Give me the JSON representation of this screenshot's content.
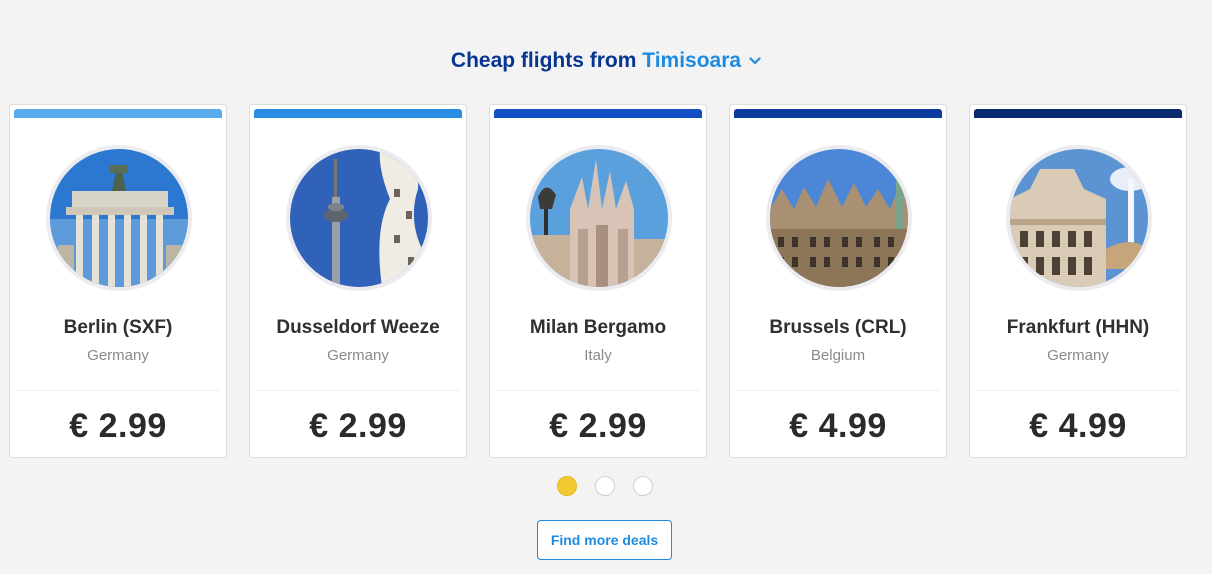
{
  "heading": {
    "prefix": "Cheap flights from",
    "city": "Timisoara",
    "chevron_icon": "chevron-down-icon"
  },
  "colors": {
    "heading": "#073590",
    "accent": "#1f8be0",
    "active_dot": "#f1c933"
  },
  "cards": [
    {
      "name": "Berlin (SXF)",
      "country": "Germany",
      "price": "€ 2.99",
      "bar_color": "#5aabeb",
      "image": "brandenburg-gate-photo"
    },
    {
      "name": "Dusseldorf Weeze",
      "country": "Germany",
      "price": "€ 2.99",
      "bar_color": "#2a8de2",
      "image": "rhine-tower-photo"
    },
    {
      "name": "Milan Bergamo",
      "country": "Italy",
      "price": "€ 2.99",
      "bar_color": "#1350c4",
      "image": "milan-cathedral-photo"
    },
    {
      "name": "Brussels (CRL)",
      "country": "Belgium",
      "price": "€ 4.99",
      "bar_color": "#0d3a9e",
      "image": "grand-place-photo"
    },
    {
      "name": "Frankfurt (HHN)",
      "country": "Germany",
      "price": "€ 4.99",
      "bar_color": "#082a6e",
      "image": "alte-oper-photo"
    }
  ],
  "pagination": {
    "count": 3,
    "active": 0
  },
  "cta": {
    "label": "Find more deals"
  }
}
